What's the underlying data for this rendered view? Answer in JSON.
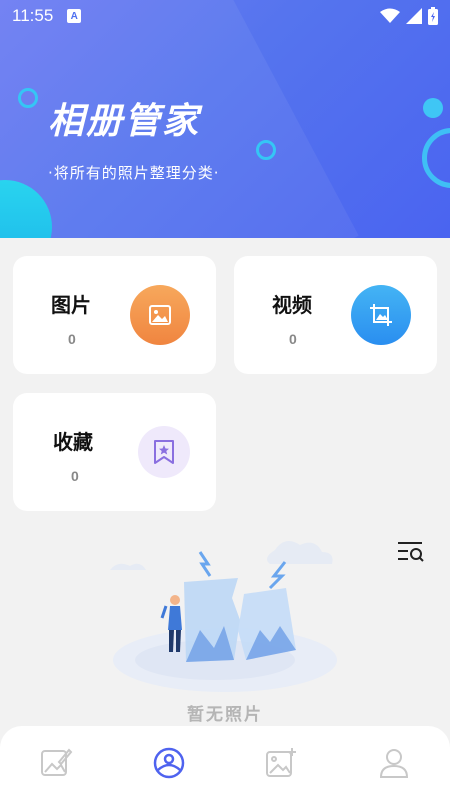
{
  "status_bar": {
    "time": "11:55",
    "notification_letter": "A"
  },
  "header": {
    "title": "相册管家",
    "subtitle": "·将所有的照片整理分类·"
  },
  "cards": {
    "photos": {
      "label": "图片",
      "count": "0"
    },
    "videos": {
      "label": "视频",
      "count": "0"
    },
    "favorites": {
      "label": "收藏",
      "count": "0"
    }
  },
  "empty_state": {
    "text": "暂无照片"
  },
  "bottom_nav": {
    "items": [
      {
        "icon": "edit-image-icon",
        "active": false
      },
      {
        "icon": "album-icon",
        "active": true
      },
      {
        "icon": "add-image-icon",
        "active": false
      },
      {
        "icon": "profile-icon",
        "active": false
      }
    ]
  },
  "colors": {
    "header_gradient": [
      "#6c7cf3",
      "#4a64f0"
    ],
    "accent": "#4f63ef",
    "photos_icon": [
      "#f7a85c",
      "#f08540"
    ],
    "videos_icon": [
      "#44b4f4",
      "#2a8ef0"
    ],
    "favorites_icon_bg": "#efe9fb",
    "favorites_icon": "#8a6fe0"
  }
}
